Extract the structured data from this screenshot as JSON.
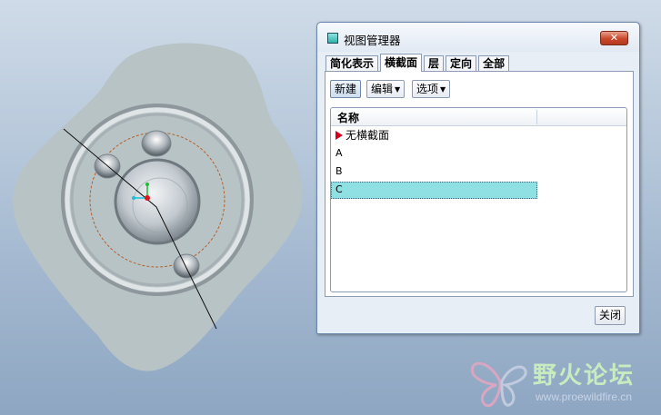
{
  "dialog": {
    "title": "视图管理器",
    "close_symbol": "✕",
    "tabs": [
      {
        "label": "简化表示"
      },
      {
        "label": "横截面"
      },
      {
        "label": "层"
      },
      {
        "label": "定向"
      },
      {
        "label": "全部"
      }
    ],
    "active_tab": "横截面",
    "toolbar": {
      "new_label": "新建",
      "edit_label": "编辑",
      "options_label": "选项"
    },
    "list": {
      "column_header": "名称",
      "rows": [
        {
          "label": "无横截面",
          "current": true
        },
        {
          "label": "A"
        },
        {
          "label": "B"
        },
        {
          "label": "C",
          "selected": true
        }
      ]
    },
    "close_label": "关闭"
  },
  "watermark": {
    "title": "野火论坛",
    "url": "www.proewildfire.cn"
  },
  "colors": {
    "background_top": "#cfdbe8",
    "background_bottom": "#8ea6c2",
    "part": "#b9c4c8",
    "selection": "#8fe0e2",
    "current_marker": "#d6001c"
  }
}
